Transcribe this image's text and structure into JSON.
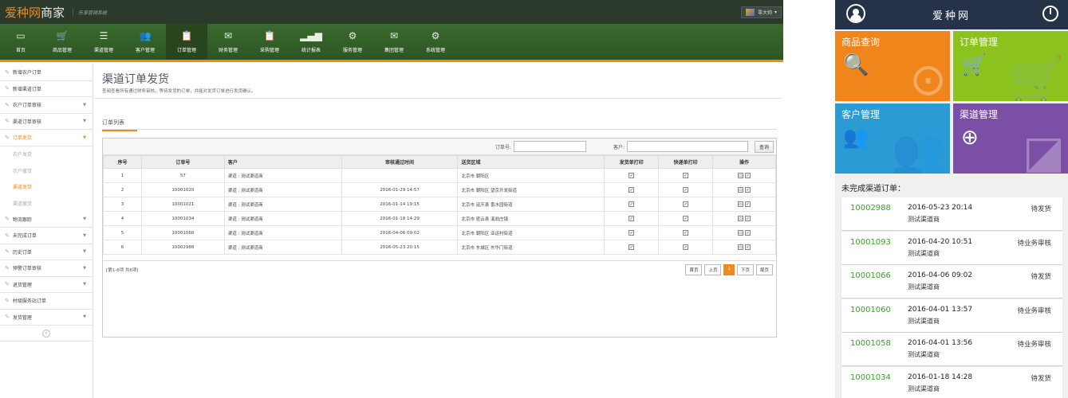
{
  "desktop": {
    "logo_brand": "爱种网",
    "logo_suffix": "商家",
    "logo_sub": "乐享营销系统",
    "user_name": "零大帅",
    "nav": [
      {
        "label": "首页",
        "icon": "monitor-icon"
      },
      {
        "label": "商品管理",
        "icon": "cart-icon"
      },
      {
        "label": "渠道管理",
        "icon": "coins-icon"
      },
      {
        "label": "客户管理",
        "icon": "users-icon"
      },
      {
        "label": "订单管理",
        "icon": "clipboard-icon"
      },
      {
        "label": "财务管理",
        "icon": "envelope-icon"
      },
      {
        "label": "采购管理",
        "icon": "clipboard-icon"
      },
      {
        "label": "统计报表",
        "icon": "bar-chart-icon"
      },
      {
        "label": "服务管理",
        "icon": "gear-icon"
      },
      {
        "label": "集团管理",
        "icon": "envelope-icon"
      },
      {
        "label": "系统管理",
        "icon": "gear-icon"
      }
    ],
    "active_nav": "订单管理",
    "sidebar": {
      "top": [
        "新增农户订单",
        "新增渠道订单",
        "农户订单审核",
        "渠道订单审核"
      ],
      "active": "订单发货",
      "subs": [
        "农户发货",
        "农户撤货",
        "渠道发货",
        "渠道撤货"
      ],
      "active_sub": "渠道发货",
      "bottom": [
        "物流跟踪",
        "未完成订单",
        "历史订单",
        "预警订单审核",
        "退货管理",
        "村级服务站订单",
        "发货管理"
      ]
    },
    "page_title": "渠道订单发货",
    "page_desc": "查阅查看所有通过财务审核，等待发货的订单，并能对发货订单进行发货确认。",
    "tab_label": "订单列表",
    "filters": {
      "order_label": "订单号:",
      "customer_label": "客户:",
      "search_btn": "查询"
    },
    "table": {
      "headers": [
        "序号",
        "订单号",
        "客户",
        "审核通过时间",
        "送货区域",
        "发货单打印",
        "快递单打印",
        "操作"
      ],
      "rows": [
        [
          "1",
          "57",
          "渠道 : 测试渠道商",
          "",
          "北京市 朝阳区"
        ],
        [
          "2",
          "10001020",
          "渠道 : 测试渠道商",
          "2016-01-29 14:57",
          "北京市 朝阳区 望京开发街道"
        ],
        [
          "3",
          "10001021",
          "渠道 : 测试渠道商",
          "2016-01-14 19:15",
          "北京市 延庆县 香水园街道"
        ],
        [
          "4",
          "10001034",
          "渠道 : 测试渠道商",
          "2016-01-18 14:29",
          "北京市 密云县 溪翁庄镇"
        ],
        [
          "5",
          "10001066",
          "渠道 : 测试渠道商",
          "2016-04-06 09:02",
          "北京市 朝阳区 亚运村街道"
        ],
        [
          "6",
          "10002988",
          "渠道 : 测试渠道商",
          "2016-05-23 20:15",
          "北京市 东城区 东华门街道"
        ]
      ]
    },
    "pager": {
      "info": "[第1-6项 共6项]",
      "first": "首页",
      "prev": "上页",
      "current": "1",
      "next": "下页",
      "last": "尾页"
    }
  },
  "mobile": {
    "title": "爱种网",
    "tiles": [
      {
        "label": "商品查询",
        "color": "#f0851c",
        "icon": "magnifier-doc-icon"
      },
      {
        "label": "订单管理",
        "color": "#8cc21e",
        "icon": "cart-icon"
      },
      {
        "label": "客户管理",
        "color": "#2a9bd4",
        "icon": "users-icon"
      },
      {
        "label": "渠道管理",
        "color": "#7b4fa6",
        "icon": "stamp-icon"
      }
    ],
    "section_title": "未完成渠道订单：",
    "orders": [
      {
        "no": "10002988",
        "date": "2016-05-23 20:14",
        "customer": "测试渠道商",
        "status": "待发货"
      },
      {
        "no": "10001093",
        "date": "2016-04-20 10:51",
        "customer": "测试渠道商",
        "status": "待业务审核"
      },
      {
        "no": "10001066",
        "date": "2016-04-06 09:02",
        "customer": "测试渠道商",
        "status": "待发货"
      },
      {
        "no": "10001060",
        "date": "2016-04-01 13:57",
        "customer": "测试渠道商",
        "status": "待业务审核"
      },
      {
        "no": "10001058",
        "date": "2016-04-01 13:56",
        "customer": "测试渠道商",
        "status": "待业务审核"
      },
      {
        "no": "10001034",
        "date": "2016-01-18 14:28",
        "customer": "测试渠道商",
        "status": "待发货"
      }
    ]
  }
}
